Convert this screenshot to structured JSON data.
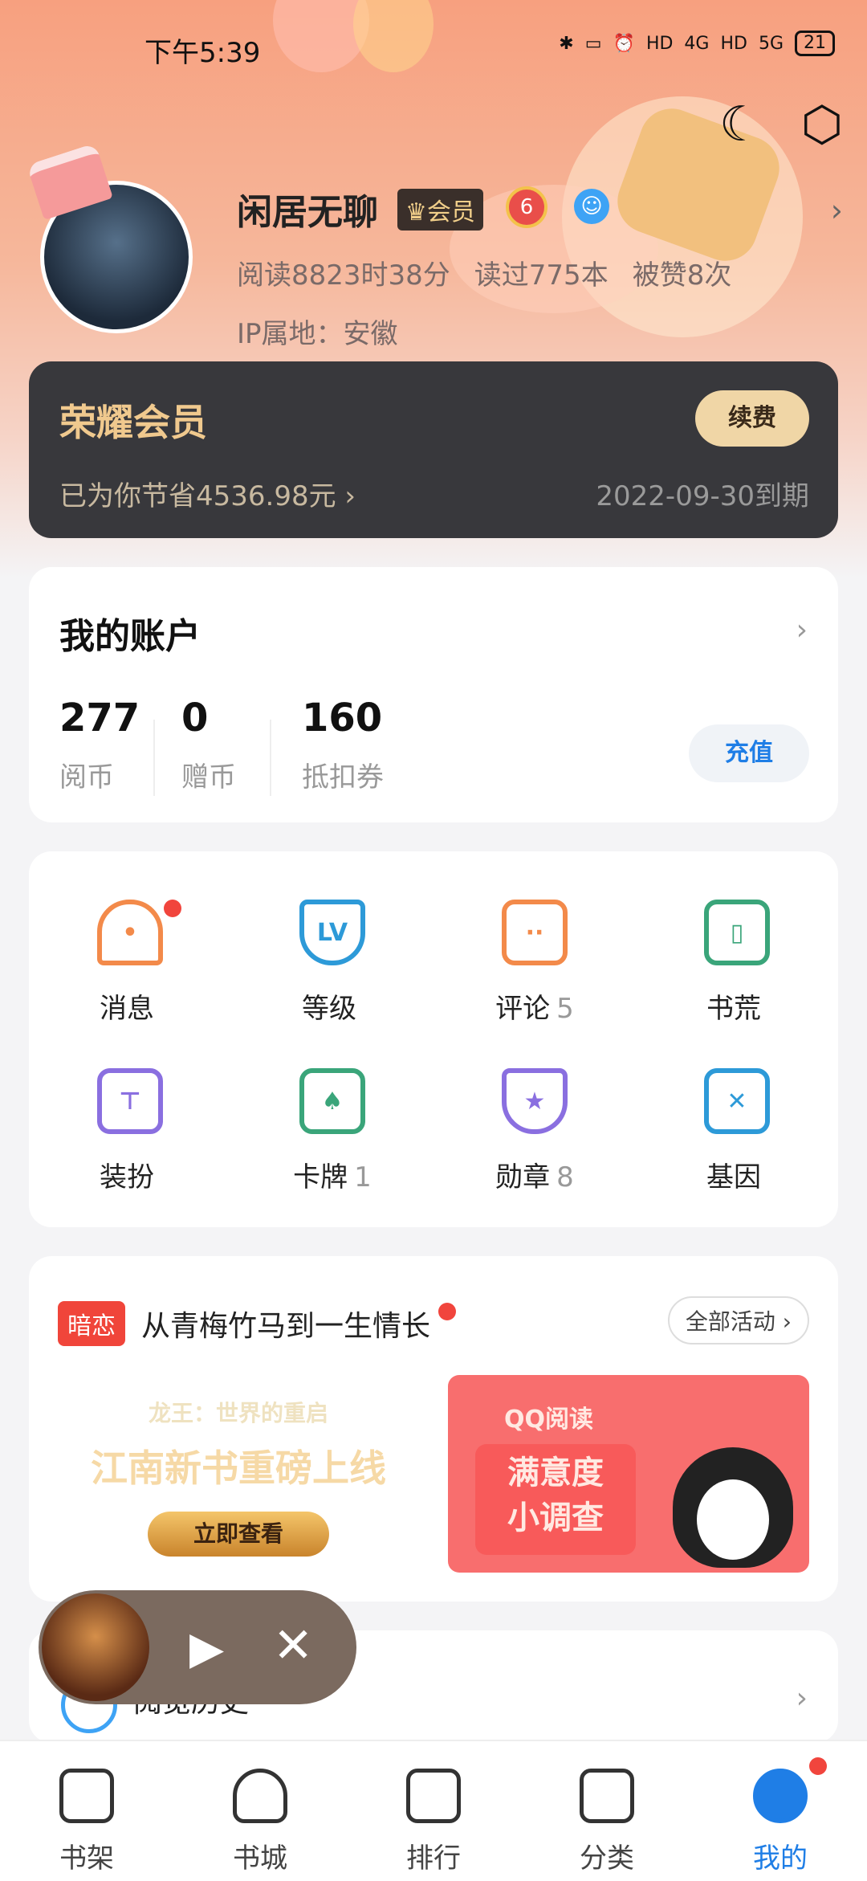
{
  "status_bar": {
    "time": "下午5:39",
    "net1": "4G",
    "net2": "5G",
    "hd": "HD",
    "battery": "21"
  },
  "profile": {
    "name": "闲居无聊",
    "vip_label": "会员",
    "level": "6",
    "stats": [
      "阅读8823时38分",
      "读过775本",
      "被赞8次"
    ],
    "ip_location": "IP属地：安徽"
  },
  "vip_card": {
    "title": "荣耀会员",
    "renew_label": "续费",
    "savings": "已为你节省4536.98元 ›",
    "expire": "2022-09-30到期"
  },
  "account": {
    "title": "我的账户",
    "items": [
      {
        "value": "277",
        "label": "阅币"
      },
      {
        "value": "0",
        "label": "赠币"
      },
      {
        "value": "160",
        "label": "抵扣券"
      }
    ],
    "recharge_label": "充值"
  },
  "features": [
    {
      "label": "消息",
      "count": ""
    },
    {
      "label": "等级",
      "count": ""
    },
    {
      "label": "评论",
      "count": "5"
    },
    {
      "label": "书荒",
      "count": ""
    },
    {
      "label": "装扮",
      "count": ""
    },
    {
      "label": "卡牌",
      "count": "1"
    },
    {
      "label": "勋章",
      "count": "8"
    },
    {
      "label": "基因",
      "count": ""
    }
  ],
  "activity": {
    "tag": "暗恋",
    "title": "从青梅竹马到一生情长",
    "all_label": "全部活动 ›",
    "banner1": {
      "subtitle": "龙王：世界的重启",
      "main": "江南新书重磅上线",
      "button": "立即查看"
    },
    "banner2": {
      "brand": "QQ阅读",
      "line1": "满意度",
      "line2": "小调查"
    }
  },
  "history": {
    "label": "阅览历史"
  },
  "tabs": [
    {
      "label": "书架"
    },
    {
      "label": "书城"
    },
    {
      "label": "排行"
    },
    {
      "label": "分类"
    },
    {
      "label": "我的"
    }
  ],
  "colors": {
    "accent": "#1f7ee6",
    "vip_gold": "#f0c98e",
    "red_dot": "#f1453d"
  }
}
